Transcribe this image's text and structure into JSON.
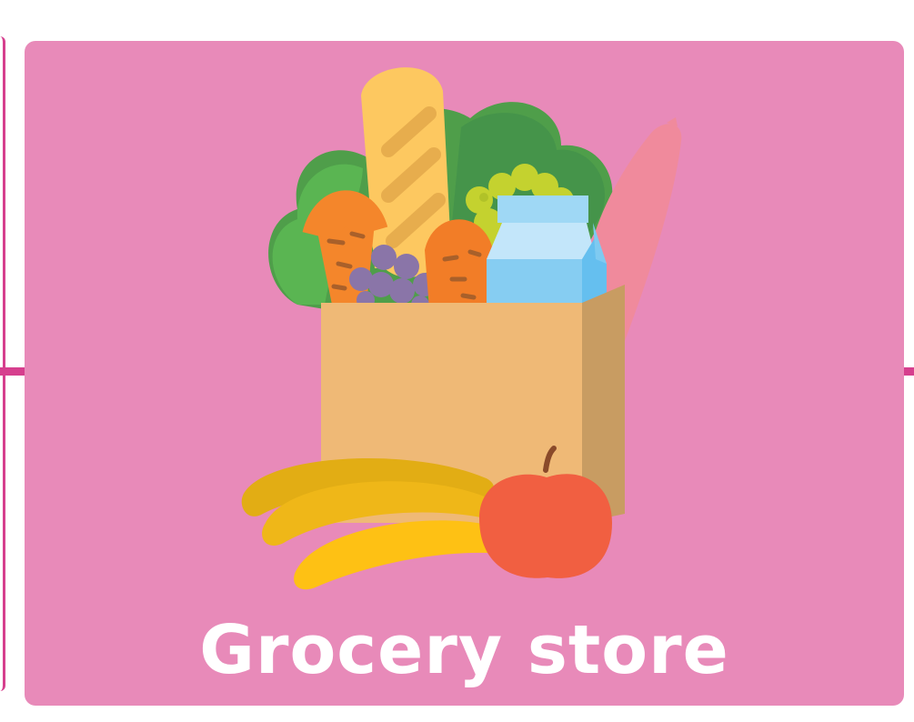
{
  "card": {
    "title": "Grocery store",
    "icon": "grocery-bag-illustration"
  },
  "colors": {
    "card_background": "#e88ab9",
    "connector": "#d63f8e",
    "label_text": "#ffffff"
  }
}
